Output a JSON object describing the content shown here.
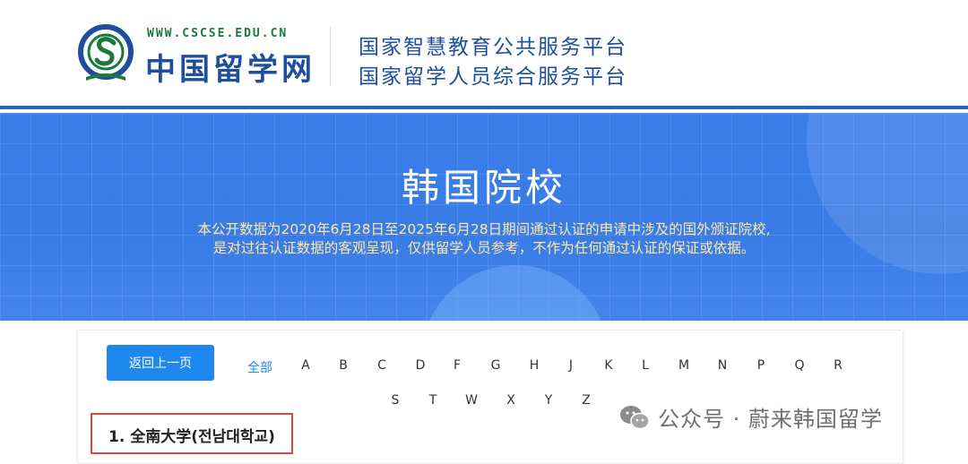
{
  "header": {
    "site_url": "WWW.CSCSE.EDU.CN",
    "site_name": "中国留学网",
    "title_line_1": "国家智慧教育公共服务平台",
    "title_line_2": "国家留学人员综合服务平台"
  },
  "banner": {
    "title": "韩国院校",
    "note_line_1": "本公开数据为2020年6月28日至2025年6月28日期间通过认证的申请中涉及的国外颁证院校,",
    "note_line_2": "是对过往认证数据的客观呈现，仅供留学人员参考，不作为任何通过认证的保证或依据。"
  },
  "nav": {
    "back_label": "返回上一页",
    "all_label": "全部",
    "letters_row_1": [
      "A",
      "B",
      "C",
      "D",
      "F",
      "G",
      "H",
      "J",
      "K",
      "L",
      "M",
      "N",
      "P",
      "Q",
      "R"
    ],
    "letters_row_2": [
      "S",
      "T",
      "W",
      "X",
      "Y",
      "Z"
    ]
  },
  "schools": [
    {
      "label": "1.  全南大学(전남대학교)"
    }
  ],
  "watermark": {
    "text": "公众号 · 蔚来韩国留学"
  },
  "colors": {
    "brand_blue": "#1f4e9c",
    "banner_blue": "#3b7ee9",
    "button_blue": "#1e88f0",
    "highlight_red": "#e0463e",
    "note_yellow": "#ffe9a8",
    "logo_green": "#1a7a3c"
  }
}
